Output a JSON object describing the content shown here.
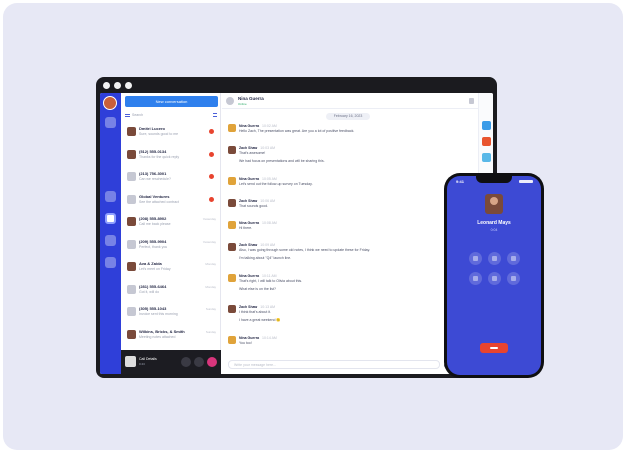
{
  "app": {
    "new_conversation_label": "New conversation",
    "search_placeholder": "Search"
  },
  "conversations": [
    {
      "name": "Dmitri Lucero",
      "preview": "Sure, sounds good to me",
      "badge": true,
      "time": ""
    },
    {
      "name": "(512) 555-0134",
      "preview": "Thanks for the quick reply",
      "badge": true,
      "time": ""
    },
    {
      "name": "(213) 756-3001",
      "preview": "Can we reschedule?",
      "badge": true,
      "time": ""
    },
    {
      "name": "Global Ventures",
      "preview": "See the attached contract",
      "badge": true,
      "time": ""
    },
    {
      "name": "(208) 555-8902",
      "preview": "Call me back please",
      "badge": false,
      "time": "Yesterday"
    },
    {
      "name": "(209) 555-9904",
      "preview": "Perfect, thank you",
      "badge": false,
      "time": "Yesterday"
    },
    {
      "name": "Ava & Zaida",
      "preview": "Let's meet on Friday",
      "badge": false,
      "time": "Monday"
    },
    {
      "name": "(281) 555-6464",
      "preview": "Got it, will do",
      "badge": false,
      "time": "Monday"
    },
    {
      "name": "(305) 555-1043",
      "preview": "Invoice sent this morning",
      "badge": false,
      "time": "Sunday"
    },
    {
      "name": "Wilkins, Bricks, & Smith",
      "preview": "Meeting notes attached",
      "badge": false,
      "time": "Sunday"
    }
  ],
  "call_bar": {
    "title": "Call Details",
    "subtitle": "0:43"
  },
  "chat": {
    "contact_name": "Nina Guerra",
    "contact_status": "Online",
    "date_label": "February 16, 2023",
    "composer_placeholder": "Write your message here...",
    "messages": [
      {
        "sender": "Nina Guerra",
        "time": "10:02 AM",
        "dark": false,
        "text": "Hello Zach, The presentation was great. Are you a lot of positive feedback.",
        "extra": ""
      },
      {
        "sender": "Zach Shaw",
        "time": "10:03 AM",
        "dark": true,
        "text": "That's awesome!",
        "extra": "We had focus on presentations and will be sharing this."
      },
      {
        "sender": "Nina Guerra",
        "time": "10:05 AM",
        "dark": false,
        "text": "Let's send out the follow-up survey on Tuesday.",
        "extra": ""
      },
      {
        "sender": "Zach Shaw",
        "time": "10:06 AM",
        "dark": true,
        "text": "That sounds good.",
        "extra": ""
      },
      {
        "sender": "Nina Guerra",
        "time": "10:08 AM",
        "dark": false,
        "text": "Hi there.",
        "extra": ""
      },
      {
        "sender": "Zach Shaw",
        "time": "10:09 AM",
        "dark": true,
        "text": "Also, I was going through some old notes, I think we need to update these for Friday.",
        "extra": "I'm talking about \"Q4\" launch line."
      },
      {
        "sender": "Nina Guerra",
        "time": "10:11 AM",
        "dark": false,
        "text": "That's right, I will talk to Olivia about this.",
        "extra": "What else is on the list?"
      },
      {
        "sender": "Zach Shaw",
        "time": "10:13 AM",
        "dark": true,
        "text": "I think that's about it.",
        "extra": "I have a great weekend 🙂"
      },
      {
        "sender": "Nina Guerra",
        "time": "10:14 AM",
        "dark": false,
        "text": "You too!",
        "extra": ""
      }
    ]
  },
  "phone": {
    "status_time": "9:41",
    "caller_name": "Leonard Mays",
    "caller_status": "0:04"
  },
  "colors": {
    "brand_blue": "#2f3fd9",
    "accent_button": "#2f80ed",
    "phone_bg": "#3d4ad4",
    "alert_red": "#e8442f"
  }
}
